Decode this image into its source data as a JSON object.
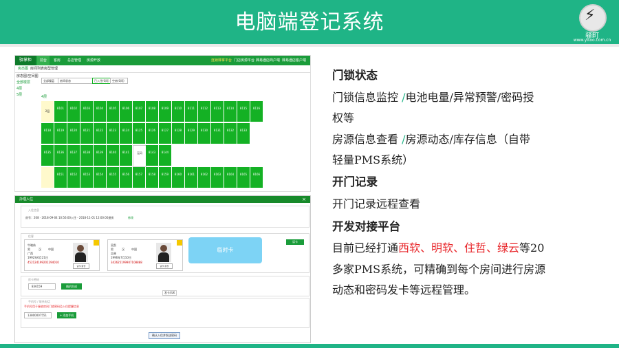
{
  "slide": {
    "title": "电脑端登记系统",
    "logo": {
      "text": "驿町",
      "url": "www.yitoo.com.cn"
    },
    "colors": {
      "header": "#1fb486",
      "room_green": "#14b124",
      "highlight_red": "#e8272b"
    }
  },
  "screen1": {
    "brand": "驿掌柜",
    "nav": [
      "前台",
      "客房",
      "总店管理",
      "房源开放"
    ],
    "nav_right": [
      "连锁驿掌平台",
      "门店房源平台",
      "驿易酒店商户端",
      "驿易酒店客户端"
    ],
    "subnav": [
      "房态图",
      "房间列表",
      "房型管理"
    ],
    "side": [
      "房态图/空间图",
      "全部楼层",
      "4层",
      "5层"
    ],
    "filters": [
      "全部楼层",
      "房间状态",
      "已入住(0间)",
      "空房(0间)"
    ],
    "floor_label": "4层",
    "rooms_row1": [
      "8101",
      "8102",
      "8103",
      "8104",
      "8105",
      "8106",
      "8107",
      "8108",
      "8109",
      "8110",
      "8111",
      "8112",
      "8113",
      "8114",
      "8115",
      "8116"
    ],
    "rooms_row2": [
      "8118",
      "8119",
      "8120",
      "8121",
      "8122",
      "8123",
      "8124",
      "8125",
      "8126",
      "8127",
      "8128",
      "8129",
      "8130",
      "8131",
      "8132",
      "8133"
    ],
    "rooms_row3": [
      "8135",
      "8136",
      "8137",
      "8138",
      "8139",
      "8140",
      "8141",
      "8142",
      "8143",
      "8144"
    ],
    "rooms_row4": [
      "8151",
      "8152",
      "8153",
      "8154",
      "8155",
      "8156",
      "8157",
      "8158",
      "8159",
      "8160",
      "8161",
      "8162",
      "8163",
      "8164",
      "8165",
      "8166"
    ],
    "yellow_label": "2层",
    "white_label": "无码"
  },
  "screen2": {
    "title": "办理入住",
    "stay_label": "入住信息",
    "stay_info": "房号：208 · 2018-09-04 10:56:00入住 - 2018-11-01 12:00:00退房",
    "stay_link": "修改",
    "guest_label": "住客",
    "guest1": {
      "name": "牛晓伟",
      "sex": "男",
      "nation": "汉",
      "country": "中国",
      "province": "广西",
      "birth": "1992年6月21日",
      "id_no": "452124199201294010",
      "btn": "读卡/身份"
    },
    "guest2": {
      "name": "吴凯",
      "sex": "男",
      "nation": "汉",
      "country": "中国",
      "province": "吉林",
      "birth": "1996年7月10日",
      "id_no": "342625199907108888",
      "btn": "读卡/身份"
    },
    "temp_card": "临时卡",
    "add_btn": "读卡",
    "card_label": "房卡密码",
    "card_value": "836159",
    "card_btn": "随机生成",
    "card_mode": "发卡/ILK",
    "phone_label": "手机号 / 联系电话",
    "phone_tip": "手机号用于接收房间门锁密码及入住提醒信息",
    "phone_value": "13800007551",
    "phone_btn": "+ 添加手机",
    "submit_btn": "确认入住并发送密码"
  },
  "right": {
    "h1": "门锁状态",
    "l1a": "门锁信息监控 ",
    "slash1": "/",
    "l1b": "电池电量/异常预警/密码授",
    "l2": "权等",
    "l3a": "房源信息查看 ",
    "slash2": "/",
    "l3b": "房源动态/库存信息（自带",
    "l4": "轻量PMS系统）",
    "h2": "开门记录",
    "l5": "开门记录远程查看",
    "h3": "开发对接平台",
    "l6a": "目前已经打通",
    "l6red": "西软、明软、住哲、绿云",
    "l6b": "等20",
    "l7": "多家PMS系统，可精确到每个房间进行房源",
    "l8": "动态和密码发卡等远程管理。"
  }
}
